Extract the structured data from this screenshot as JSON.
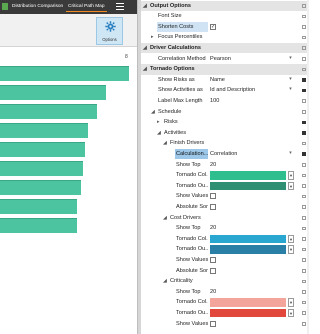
{
  "app": {
    "tabs": [
      {
        "label": "Distribution Comparison"
      },
      {
        "label": "Critical Path Map"
      }
    ],
    "ribbon": {
      "options_label": "Options"
    },
    "chart": {
      "axis_tick": "8",
      "bar_color": "#4cc4a0",
      "bar_lengths_pct": [
        100,
        82,
        75,
        68,
        66,
        64,
        63,
        60,
        60
      ]
    }
  },
  "grid": {
    "rows": [
      {
        "label": "Output Options",
        "kind": "section",
        "arrow": "◢"
      },
      {
        "label": "Font Size",
        "kind": "prop",
        "indent": 1
      },
      {
        "label": "Shorten Costs",
        "kind": "prop",
        "indent": 1,
        "checkbox": "✓",
        "selected": true
      },
      {
        "label": "Focus Percentiles",
        "kind": "prop",
        "indent": 1,
        "arrow": "▸"
      },
      {
        "label": "Driver Calculations",
        "kind": "section",
        "arrow": "◢"
      },
      {
        "label": "Correlation Method",
        "kind": "prop",
        "indent": 1,
        "value": "Pearson",
        "dropdown": true
      },
      {
        "label": "Tornado Options",
        "kind": "section",
        "arrow": "◢"
      },
      {
        "label": "Show Risks as",
        "kind": "prop",
        "indent": 1,
        "value": "Name",
        "dropdown": true,
        "pin_filled": true
      },
      {
        "label": "Show Activities as",
        "kind": "prop",
        "indent": 1,
        "value": "Id and Description",
        "dropdown": true,
        "pin_filled": true
      },
      {
        "label": "Label Max Length",
        "kind": "prop",
        "indent": 1,
        "value": "100"
      },
      {
        "label": "Schedule",
        "kind": "prop",
        "indent": 1,
        "arrow": "◢"
      },
      {
        "label": "Risks",
        "kind": "prop",
        "indent": 2,
        "arrow": "▸",
        "pin_filled": true
      },
      {
        "label": "Activities",
        "kind": "prop",
        "indent": 2,
        "arrow": "◢",
        "pin_filled": true
      },
      {
        "label": "Finish Drivers",
        "kind": "prop",
        "indent": 3,
        "arrow": "◢"
      },
      {
        "label": "Calculation...",
        "kind": "prop",
        "indent": 4,
        "value": "Correlation",
        "dropdown": true,
        "sel_strong": true,
        "pin_filled": true
      },
      {
        "label": "Show Top",
        "kind": "prop",
        "indent": 4,
        "value": "20"
      },
      {
        "label": "Tornado Col...",
        "kind": "prop",
        "indent": 4,
        "swatch": "#2fbf8f"
      },
      {
        "label": "Tornado Ou...",
        "kind": "prop",
        "indent": 4,
        "swatch": "#2e8f72"
      },
      {
        "label": "Show Values",
        "kind": "prop",
        "indent": 4,
        "checkbox": ""
      },
      {
        "label": "Absolute Sort",
        "kind": "prop",
        "indent": 4,
        "checkbox": ""
      },
      {
        "label": "Cost Drivers",
        "kind": "prop",
        "indent": 3,
        "arrow": "◢"
      },
      {
        "label": "Show Top",
        "kind": "prop",
        "indent": 4,
        "value": "20"
      },
      {
        "label": "Tornado Col...",
        "kind": "prop",
        "indent": 4,
        "swatch": "#29a7d1"
      },
      {
        "label": "Tornado Ou...",
        "kind": "prop",
        "indent": 4,
        "swatch": "#2a7fa6"
      },
      {
        "label": "Show Values",
        "kind": "prop",
        "indent": 4,
        "checkbox": ""
      },
      {
        "label": "Absolute Sort",
        "kind": "prop",
        "indent": 4,
        "checkbox": ""
      },
      {
        "label": "Criticality",
        "kind": "prop",
        "indent": 3,
        "arrow": "◢"
      },
      {
        "label": "Show Top",
        "kind": "prop",
        "indent": 4,
        "value": "20"
      },
      {
        "label": "Tornado Col...",
        "kind": "prop",
        "indent": 4,
        "swatch": "#f3a49b"
      },
      {
        "label": "Tornado Ou...",
        "kind": "prop",
        "indent": 4,
        "swatch": "#e2473c"
      },
      {
        "label": "Show Values",
        "kind": "prop",
        "indent": 4,
        "checkbox": ""
      }
    ]
  }
}
